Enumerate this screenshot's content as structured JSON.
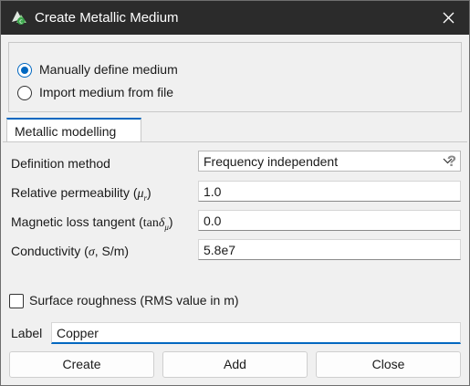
{
  "window": {
    "title": "Create Metallic Medium"
  },
  "source": {
    "options": [
      {
        "label": "Manually define medium",
        "checked": true
      },
      {
        "label": "Import medium from file",
        "checked": false
      }
    ]
  },
  "tab": {
    "label": "Metallic modelling"
  },
  "form": {
    "definition_method": {
      "label": "Definition method",
      "value": "Frequency independent",
      "help": "?"
    },
    "permeability": {
      "label": "Relative permeability (",
      "symbol": "μ",
      "sub": "r",
      "close": ")",
      "value": "1.0"
    },
    "loss_tangent": {
      "label": "Magnetic loss tangent (",
      "tan": "tan",
      "symbol": "δ",
      "sub": "μ",
      "close": ")",
      "value": "0.0"
    },
    "conductivity": {
      "label": "Conductivity (",
      "symbol": "σ",
      "unit": ", S/m)",
      "value": "5.8e7"
    }
  },
  "roughness": {
    "label": "Surface roughness (RMS value in m)",
    "checked": false
  },
  "label_field": {
    "label": "Label",
    "value": "Copper"
  },
  "buttons": {
    "create": "Create",
    "add": "Add",
    "close": "Close"
  },
  "colors": {
    "titlebar": "#2b2b2b",
    "accent": "#0067c0",
    "dialog_bg": "#f0f0f0"
  }
}
